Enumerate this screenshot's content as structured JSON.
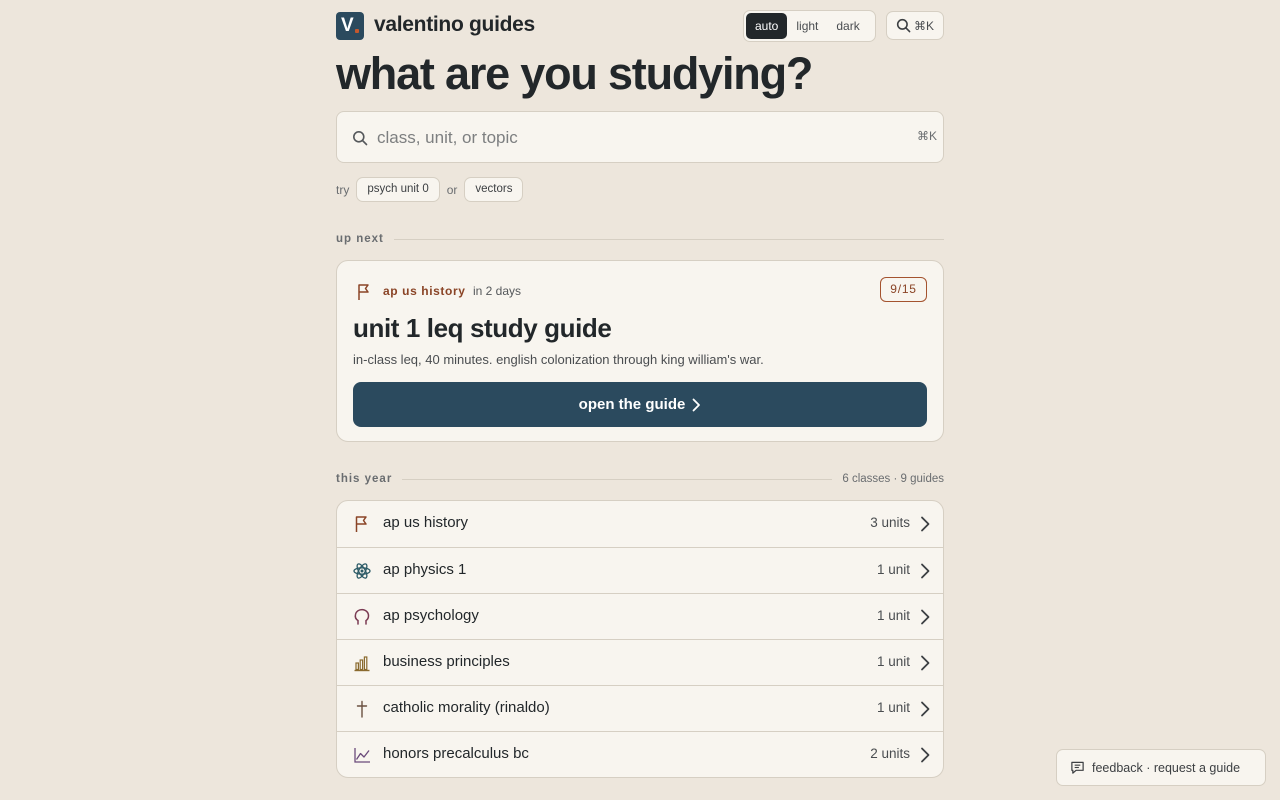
{
  "brand": {
    "logo_letter": "V",
    "name": "valentino guides"
  },
  "theme": {
    "options": [
      "auto",
      "light",
      "dark"
    ],
    "selected": "auto"
  },
  "header_search": {
    "shortcut": "⌘K"
  },
  "hero": {
    "title": "what are you studying?"
  },
  "search": {
    "placeholder": "class, unit, or topic",
    "value": "",
    "shortcut": "⌘K"
  },
  "suggestions": {
    "try_label": "try",
    "or_label": "or",
    "chips": [
      "psych unit 0",
      "vectors"
    ]
  },
  "up_next": {
    "section_label": "up next",
    "course": "ap us history",
    "when": "in 2 days",
    "date_badge": "9/15",
    "title": "unit 1 leq study guide",
    "description": "in-class leq, 40 minutes. english colonization through king william's war.",
    "button_label": "open the guide"
  },
  "this_year": {
    "section_label": "this year",
    "summary": "6 classes · 9 guides",
    "classes": [
      {
        "name": "ap us history",
        "units": "3 units",
        "icon": "flag-icon",
        "color": "#8a4426"
      },
      {
        "name": "ap physics 1",
        "units": "1 unit",
        "icon": "atom-icon",
        "color": "#2b5a66"
      },
      {
        "name": "ap psychology",
        "units": "1 unit",
        "icon": "head-icon",
        "color": "#7a3a52"
      },
      {
        "name": "business principles",
        "units": "1 unit",
        "icon": "bar-chart-icon",
        "color": "#8a6a2e"
      },
      {
        "name": "catholic morality (rinaldo)",
        "units": "1 unit",
        "icon": "cross-icon",
        "color": "#6a5040"
      },
      {
        "name": "honors precalculus bc",
        "units": "2 units",
        "icon": "line-chart-icon",
        "color": "#6a4a7a"
      }
    ]
  },
  "feedback": {
    "label": "feedback · request a guide"
  },
  "colors": {
    "background": "#ede6dc",
    "card": "#f8f5ef",
    "primary": "#2b4a5e",
    "accent": "#8a4426",
    "text": "#22272a"
  }
}
